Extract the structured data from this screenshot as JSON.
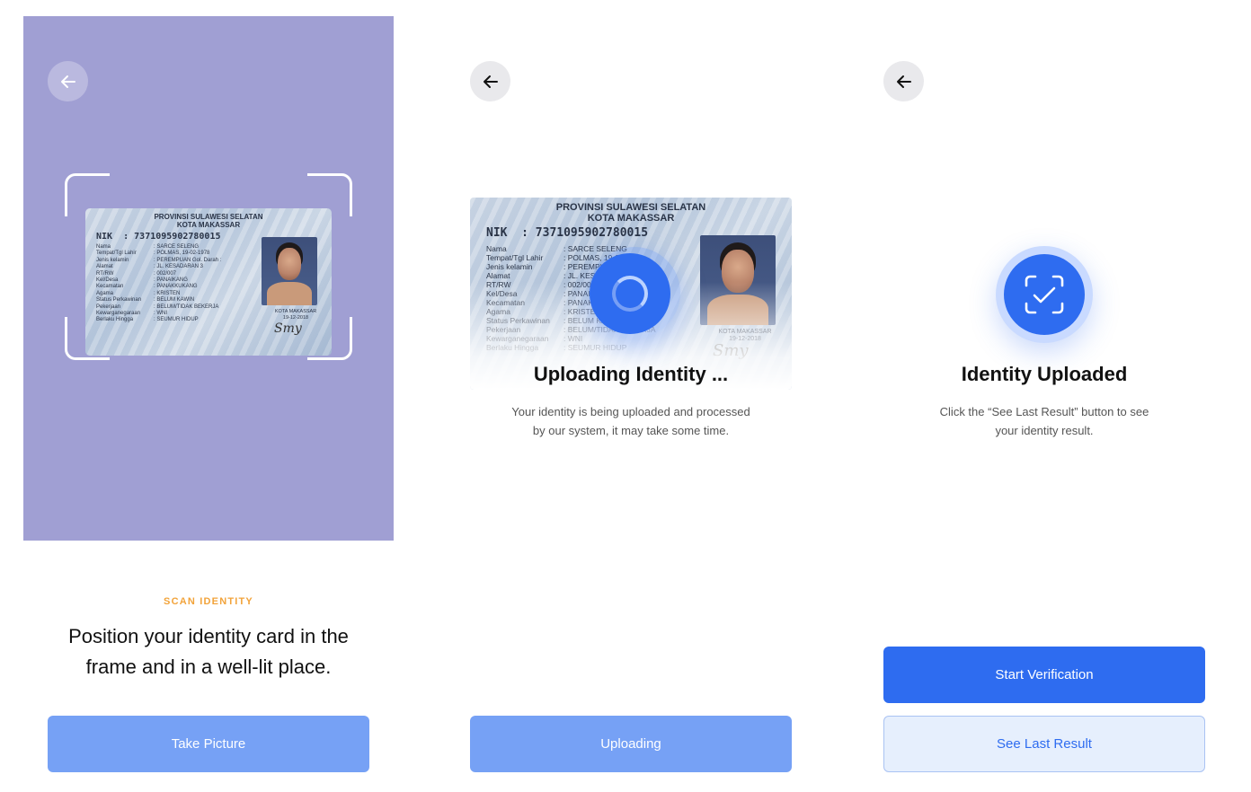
{
  "colors": {
    "camera_bg": "#a09fd3",
    "primary": "#2e6cf0",
    "primary_light": "#76a1f5",
    "outline_bg": "#e6effd",
    "eyebrow": "#f2a33a"
  },
  "icons": {
    "back": "arrow-left-icon",
    "spinner": "loading-spinner-icon",
    "verified": "scan-check-icon"
  },
  "id_card": {
    "province": "PROVINSI SULAWESI SELATAN",
    "city": "KOTA MAKASSAR",
    "nik_label": "NIK",
    "nik_value": ": 7371095902780015",
    "fields": [
      {
        "key": "Nama",
        "value": ": SARCE SELENG"
      },
      {
        "key": "Tempat/Tgl Lahir",
        "value": ": POLMAS, 19-02-1978"
      },
      {
        "key": "Jenis kelamin",
        "value": ": PEREMPUAN    Gol. Darah :"
      },
      {
        "key": "Alamat",
        "value": ": JL. KESADARAN 3"
      },
      {
        "key": "RT/RW",
        "value": ": 002/007"
      },
      {
        "key": "Kel/Desa",
        "value": ": PANAIKANG"
      },
      {
        "key": "Kecamatan",
        "value": ": PANAKKUKANG"
      },
      {
        "key": "Agama",
        "value": ": KRISTEN"
      },
      {
        "key": "Status Perkawinan",
        "value": ": BELUM KAWIN"
      },
      {
        "key": "Pekerjaan",
        "value": ": BELUM/TIDAK BEKERJA"
      },
      {
        "key": "Kewarganegaraan",
        "value": ": WNI"
      },
      {
        "key": "Berlaku Hingga",
        "value": ": SEUMUR HIDUP"
      }
    ],
    "issue_city": "KOTA MAKASSAR",
    "issue_date": "19-12-2018",
    "signature": "Smy"
  },
  "scan_screen": {
    "eyebrow": "SCAN IDENTITY",
    "headline_line1": "Position your identity card in the",
    "headline_line2": "frame and in a well-lit place.",
    "button": "Take Picture"
  },
  "upload_screen": {
    "title": "Uploading Identity ...",
    "desc_line1": "Your identity is being uploaded and processed",
    "desc_line2": "by our system, it may take some time.",
    "button": "Uploading"
  },
  "done_screen": {
    "title": "Identity Uploaded",
    "desc_line1": "Click the “See Last Result” button to see",
    "desc_line2": "your identity result.",
    "primary_button": "Start Verification",
    "secondary_button": "See Last Result"
  }
}
